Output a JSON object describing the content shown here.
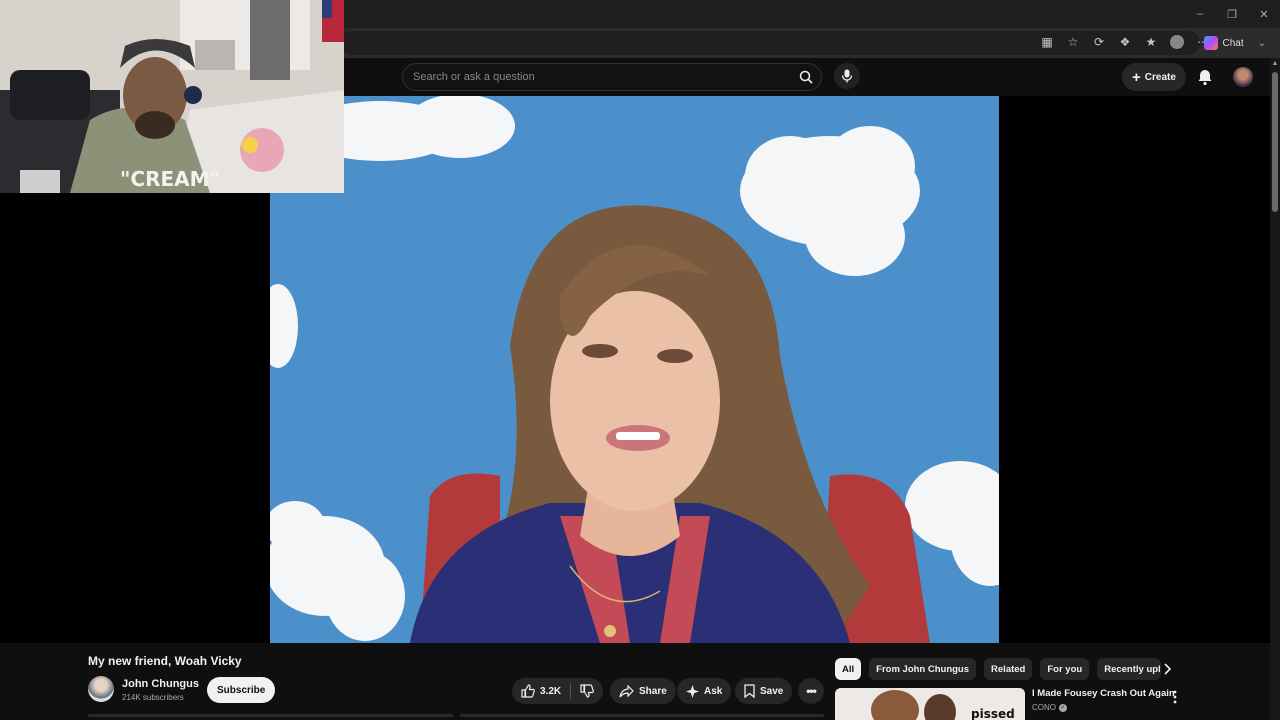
{
  "browser": {
    "chat_label": "Chat",
    "window_controls": [
      "minimize-icon",
      "restore-icon",
      "close-icon"
    ],
    "toolbar_icons": [
      "app-grid-icon",
      "star-icon",
      "refresh-icon",
      "extensions-icon",
      "favorites-icon",
      "profile-icon",
      "more-icon"
    ]
  },
  "header": {
    "search_placeholder": "Search or ask a question",
    "create_label": "Create"
  },
  "video": {
    "title": "My new friend, Woah Vicky",
    "channel_name": "John Chungus",
    "subscribers": "214K subscribers",
    "subscribe_label": "Subscribe",
    "like_count": "3.2K",
    "share_label": "Share",
    "ask_label": "Ask",
    "save_label": "Save"
  },
  "chips": [
    {
      "label": "All",
      "active": true
    },
    {
      "label": "From John Chungus"
    },
    {
      "label": "Related"
    },
    {
      "label": "For you"
    },
    {
      "label": "Recently uploaded"
    }
  ],
  "recommendation": {
    "title": "I Made Fousey Crash Out Again",
    "channel": "CONO",
    "thumb_text": "pissed"
  },
  "colors": {
    "background": "#0f0f0f",
    "sky": "#4a8fcc",
    "pill": "#272727",
    "subscribe_bg": "#f1f1f1"
  }
}
